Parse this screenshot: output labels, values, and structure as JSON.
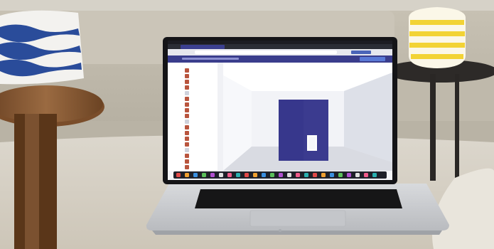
{
  "scene": {
    "colors": {
      "sofa": "#bdb7a9",
      "wood_table": "#8a5a35",
      "laptop_body": "#c9cbcf",
      "keyboard": "#161617",
      "screen_accent": "#3b3b8f",
      "menubar": "#1c1c22",
      "vase_yellow": "#f2d335"
    },
    "icons": [
      "wave-pillow-icon",
      "striped-vase-icon",
      "apple-logo-icon"
    ]
  },
  "laptop": {
    "app": {
      "nav_items": [
        "",
        "",
        "",
        "",
        "",
        "",
        "",
        "",
        "",
        "",
        "",
        "",
        "",
        "",
        "",
        "",
        "",
        ""
      ],
      "toolbar_button": "",
      "dock_apps": [
        "",
        "",
        "",
        "",
        "",
        "",
        "",
        "",
        "",
        "",
        "",
        "",
        "",
        "",
        "",
        "",
        "",
        "",
        "",
        "",
        "",
        "",
        "",
        ""
      ]
    }
  }
}
